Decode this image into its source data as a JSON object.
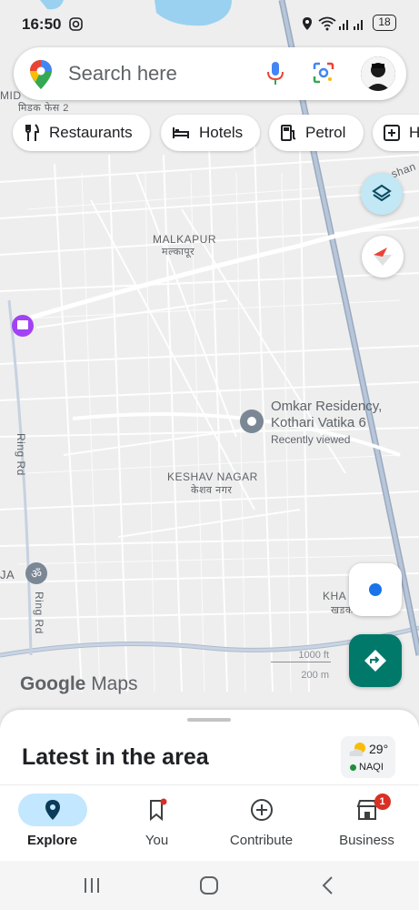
{
  "status_bar": {
    "time": "16:50",
    "battery": "18"
  },
  "search": {
    "placeholder": "Search here"
  },
  "chips": [
    {
      "label": "Restaurants",
      "icon": "fork-knife-icon"
    },
    {
      "label": "Hotels",
      "icon": "bed-icon"
    },
    {
      "label": "Petrol",
      "icon": "fuel-icon"
    },
    {
      "label": "H",
      "icon": "plus-box-icon"
    }
  ],
  "map": {
    "labels": {
      "top_left_1": "MID",
      "top_left_2": "मिडक फेस 2",
      "malkapur": "MALKAPUR",
      "malkapur_hi": "मल्कापूर",
      "keshav": "KESHAV NAGAR",
      "keshav_hi": "केशव नगर",
      "ring_rd_1": "Ring Rd",
      "ring_rd_2": "Ring Rd",
      "ja": "JA",
      "kha": "KHA",
      "kha_hi": "खडक",
      "shan": "shan",
      "scale_ft": "1000 ft",
      "scale_m": "200 m",
      "place_name_1": "Omkar Residency,",
      "place_name_2": "Kothari Vatika 6",
      "place_sub": "Recently viewed",
      "google": "Google",
      "maps": "Maps"
    }
  },
  "sheet": {
    "title": "Latest in the area",
    "weather_temp": "29°",
    "weather_aqi": "NAQI"
  },
  "nav": [
    {
      "label": "Explore",
      "active": true
    },
    {
      "label": "You",
      "active": false
    },
    {
      "label": "Contribute",
      "active": false
    },
    {
      "label": "Business",
      "active": false,
      "badge": "1"
    }
  ],
  "colors": {
    "accent": "#1a73e8",
    "nav_active_bg": "#c2e7ff",
    "directions": "#00796b"
  }
}
